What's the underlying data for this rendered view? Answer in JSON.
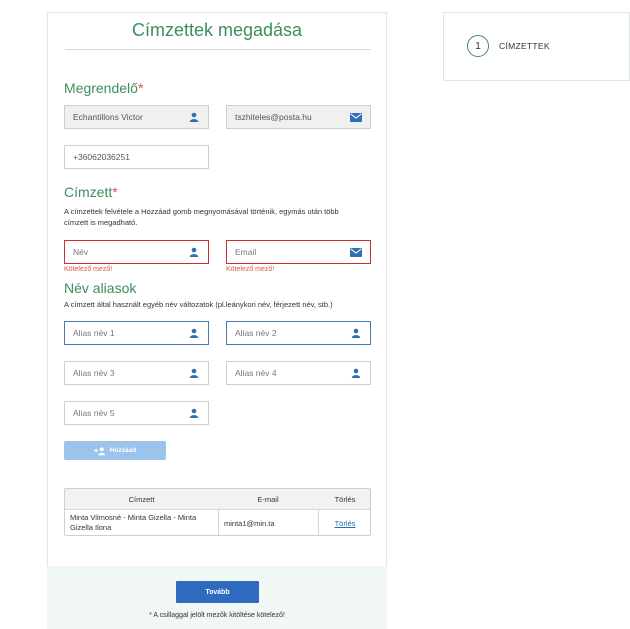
{
  "form": {
    "title": "Címzettek megadása",
    "sections": {
      "orderer": {
        "title": "Megrendelő",
        "required_mark": "*"
      },
      "recipient": {
        "title": "Címzett",
        "required_mark": "*",
        "description_line1": "A címzettek felvétele a Hozzáad gomb megnyomásával történik, egymás után több",
        "description_line2": "címzett is megadható."
      },
      "aliases": {
        "title": "Név aliasok",
        "description": "A címzett által használt egyéb név változatok (pl.leánykori név, férjezett név, stb.)"
      }
    },
    "fields": {
      "orderer_name": {
        "value": "Echantillons Victor",
        "icon": "user-icon"
      },
      "orderer_email": {
        "value": "tszhiteles@posta.hu",
        "icon": "envelope-icon"
      },
      "orderer_phone": {
        "value": "+36062036251"
      },
      "recipient_name": {
        "placeholder": "Név",
        "icon": "user-icon",
        "error": "Kötelező mező!"
      },
      "recipient_email": {
        "placeholder": "Email",
        "icon": "envelope-icon",
        "error": "Kötelező mező!"
      },
      "alias1": {
        "placeholder": "Alias név 1",
        "icon": "user-icon"
      },
      "alias2": {
        "placeholder": "Alias név 2",
        "icon": "user-icon"
      },
      "alias3": {
        "placeholder": "Alias név 3",
        "icon": "user-icon"
      },
      "alias4": {
        "placeholder": "Alias név 4",
        "icon": "user-icon"
      },
      "alias5": {
        "placeholder": "Alias név 5",
        "icon": "user-icon"
      }
    },
    "add_button": {
      "label": "Hozzáad",
      "icon": "add-user-icon"
    },
    "table": {
      "headers": [
        "Címzett",
        "E-mail",
        "Törlés"
      ],
      "rows": [
        {
          "recipient": "Minta Vilmosné - Minta Gizella - Minta Gizella Ilona",
          "email": "minta1@min.ta",
          "delete": "Törlés"
        }
      ]
    },
    "next_button": {
      "label": "Tovább"
    },
    "footnote": "* A csillaggal jelölt mezők kitöltése kötelező!"
  },
  "steps": [
    {
      "number": "1",
      "label": "CÍMZETTEK"
    }
  ],
  "colors": {
    "accent_green": "#3e8e5e",
    "error_red": "#c9302c",
    "primary_blue": "#2e6bbf",
    "disabled_blue": "#9cc3ea",
    "icon_blue": "#2f6fb5"
  }
}
